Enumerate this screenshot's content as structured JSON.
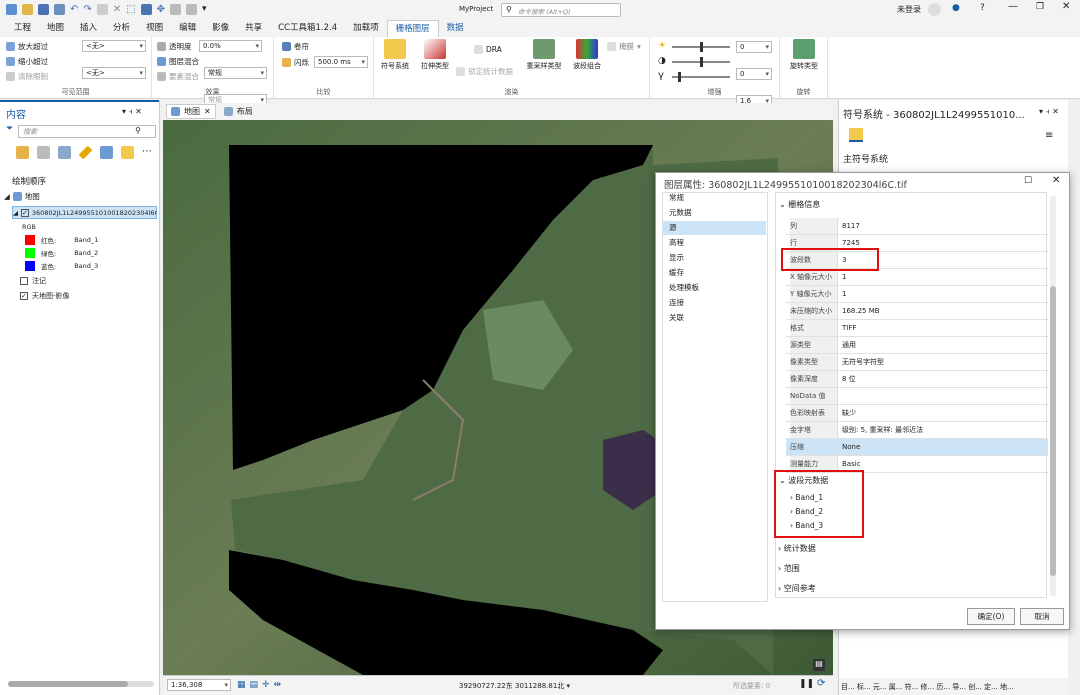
{
  "app": {
    "project": "MyProject",
    "search_placeholder": "命令搜索 (Alt+Q)",
    "login": "未登录",
    "login_initial": "",
    "help": "?"
  },
  "tabs": [
    "工程",
    "地图",
    "插入",
    "分析",
    "视图",
    "编辑",
    "影像",
    "共享",
    "CC工具箱1.2.4",
    "加载项",
    "栅格图层",
    "数据"
  ],
  "ribbon": {
    "visible_range": {
      "zoom_in": "放大超过",
      "zoom_out": "缩小超过",
      "clear": "清除限制",
      "combo1": "<无>",
      "combo2": "<无>",
      "label": "可见范围"
    },
    "effects": {
      "transparency": "透明度",
      "transparency_val": "0.0%",
      "blend": "图层混合",
      "blend_val": "常规",
      "feature_blend": "要素混合",
      "feature_blend_val": "常规",
      "label": "效果"
    },
    "compare": {
      "swipe": "卷帘",
      "flicker": "闪烁",
      "flicker_val": "500.0  ms",
      "label": "比较"
    },
    "rendering": {
      "symbology": "符号系统",
      "stretch": "拉伸类型",
      "dra": "DRA",
      "lock_stats": "锁定统计数据",
      "resample": "重采样类型",
      "band_combo": "波段组合",
      "mask": "掩膜",
      "label": "渲染"
    },
    "enhance": {
      "brightness": "0",
      "contrast": "0",
      "gamma": "1.6",
      "label": "增强"
    },
    "rotate": {
      "rotate_type": "旋转类型",
      "label": "旋转"
    }
  },
  "contents": {
    "title": "内容",
    "search": "搜索",
    "draw_order": "绘制顺序",
    "map": "地图",
    "layer": "360802JL1L2499551010018202304l6C",
    "rgb": "RGB",
    "red": "红色:",
    "green": "绿色:",
    "blue": "蓝色:",
    "band1": "Band_1",
    "band2": "Band_2",
    "band3": "Band_3",
    "annotation": "注记",
    "basemap": "天地图-影像"
  },
  "map_tabs": {
    "map": "地图",
    "layout": "布局"
  },
  "symbology": {
    "title": "符号系统 - 360802JL1L2499551010...",
    "primary": "主符号系统"
  },
  "dialog": {
    "title": "图层属性: 360802JL1L2499551010018202304l6C.tif",
    "nav": [
      "常规",
      "元数据",
      "源",
      "高程",
      "显示",
      "缓存",
      "处理模板",
      "连接",
      "关联"
    ],
    "raster_info": "栅格信息",
    "rows": [
      {
        "k": "列",
        "v": "8117"
      },
      {
        "k": "行",
        "v": "7245"
      },
      {
        "k": "波段数",
        "v": "3"
      },
      {
        "k": "X 轴像元大小",
        "v": "1"
      },
      {
        "k": "Y 轴像元大小",
        "v": "1"
      },
      {
        "k": "未压缩的大小",
        "v": "168.25 MB"
      },
      {
        "k": "格式",
        "v": "TIFF"
      },
      {
        "k": "源类型",
        "v": "通用"
      },
      {
        "k": "像素类型",
        "v": "无符号字符型"
      },
      {
        "k": "像素深度",
        "v": "8 位"
      },
      {
        "k": "NoData 值",
        "v": ""
      },
      {
        "k": "色彩映射表",
        "v": "缺少"
      },
      {
        "k": "金字塔",
        "v": "级别: 5, 重采样: 最邻近法"
      },
      {
        "k": "压缩",
        "v": "None"
      },
      {
        "k": "测量能力",
        "v": "Basic"
      }
    ],
    "band_meta": "波段元数据",
    "bands": [
      "Band_1",
      "Band_2",
      "Band_3"
    ],
    "stats": "统计数据",
    "extent": "范围",
    "spatial_ref": "空间参考",
    "ok": "确定(O)",
    "cancel": "取消"
  },
  "status": {
    "scale": "1:36,308",
    "coords": "39290727.22东 3011288.81北 ▾",
    "selected": "所选要素: 0"
  },
  "bottom_tabs": "目...  标...  元...  属...  符...  修...  历...  导...  创...  定...  地...",
  "colors": {
    "accent": "#1a5ea6",
    "highlight": "#e01010",
    "selection": "#cde4f7"
  }
}
